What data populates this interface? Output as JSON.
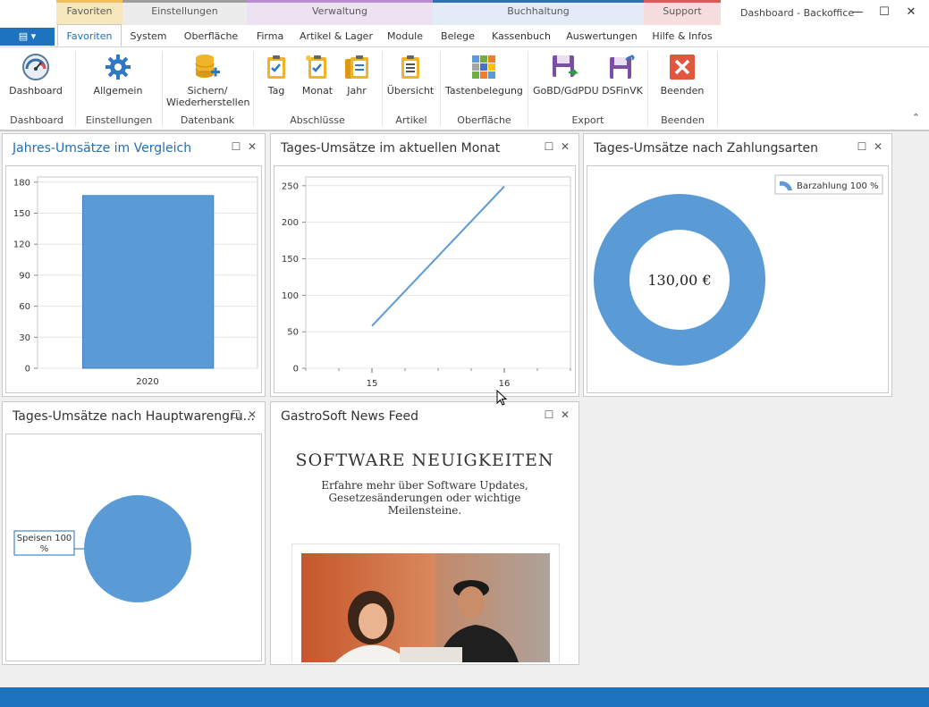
{
  "window": {
    "title": "Dashboard - Backoffice",
    "minimize": "—",
    "maximize": "☐",
    "close": "✕"
  },
  "context_groups": [
    {
      "label": "Favoriten",
      "color": "#f5e3b3",
      "bar": "#f0c060"
    },
    {
      "label": "Einstellungen",
      "color": "#e8e8e8",
      "bar": "#a0a0a0"
    },
    {
      "label": "Verwaltung",
      "color": "#eadcf0",
      "bar": "#b98ccf"
    },
    {
      "label": "Buchhaltung",
      "color": "#dde8f5",
      "bar": "#7aa6d6"
    },
    {
      "label": "Support",
      "color": "#f5dada",
      "bar": "#e08080"
    }
  ],
  "app_menu": "▤ ▾",
  "tabs": [
    "Favoriten",
    "System",
    "Oberfläche",
    "Firma",
    "Artikel & Lager",
    "Module",
    "Belege",
    "Kassenbuch",
    "Auswertungen",
    "Hilfe & Infos"
  ],
  "ribbon": {
    "buttons": {
      "dashboard": "Dashboard",
      "allgemein": "Allgemein",
      "sichern_1": "Sichern/",
      "sichern_2": "Wiederherstellen",
      "tag": "Tag",
      "monat": "Monat",
      "jahr": "Jahr",
      "uebersicht": "Übersicht",
      "tastenbelegung": "Tastenbelegung",
      "gobd": "GoBD/GdPDU",
      "dsfinvk": "DSFinVK",
      "beenden": "Beenden"
    },
    "groups": {
      "dashboard": "Dashboard",
      "einstellungen": "Einstellungen",
      "datenbank": "Datenbank",
      "abschluesse": "Abschlüsse",
      "artikel": "Artikel",
      "oberflaeche": "Oberfläche",
      "export": "Export",
      "beenden": "Beenden"
    },
    "collapse": "⌃"
  },
  "panels": {
    "jahres": {
      "title": "Jahres-Umsätze im Vergleich",
      "max": "☐",
      "close": "✕"
    },
    "tages": {
      "title": "Tages-Umsätze im aktuellen Monat",
      "max": "☐",
      "close": "✕"
    },
    "zahlungsarten": {
      "title": "Tages-Umsätze nach Zahlungsarten",
      "max": "☐",
      "close": "✕"
    },
    "hauptwaren": {
      "title": "Tages-Umsätze nach Hauptwarengru...",
      "max": "☐",
      "close": "✕"
    },
    "news": {
      "title": "GastroSoft News Feed",
      "max": "☐",
      "close": "✕",
      "headline": "SOFTWARE NEUIGKEITEN",
      "subtext": "Erfahre mehr über Software Updates, Gesetzesänderungen oder wichtige Meilensteine."
    }
  },
  "chart_data": [
    {
      "type": "bar",
      "categories": [
        "2020"
      ],
      "values": [
        167
      ],
      "yticks": [
        0,
        30,
        60,
        90,
        120,
        150,
        180
      ],
      "ylim": [
        0,
        185
      ],
      "color": "#5b9bd5"
    },
    {
      "type": "line",
      "x": [
        15,
        16
      ],
      "y": [
        58,
        249
      ],
      "xticks": [
        15,
        16
      ],
      "yticks": [
        0,
        50,
        100,
        150,
        200,
        250
      ],
      "xlim": [
        14.5,
        16.5
      ],
      "ylim": [
        0,
        262
      ],
      "color": "#5b9bd5"
    },
    {
      "type": "pie",
      "variant": "donut",
      "slices": [
        {
          "label": "Barzahlung",
          "percent": "100 %",
          "value": 100
        }
      ],
      "center_label": "130,00 €",
      "legend": "top-right",
      "color": "#5b9bd5"
    },
    {
      "type": "pie",
      "slices": [
        {
          "label": "Speisen",
          "percent": "100 %",
          "value": 100
        }
      ],
      "color": "#5b9bd5"
    }
  ]
}
